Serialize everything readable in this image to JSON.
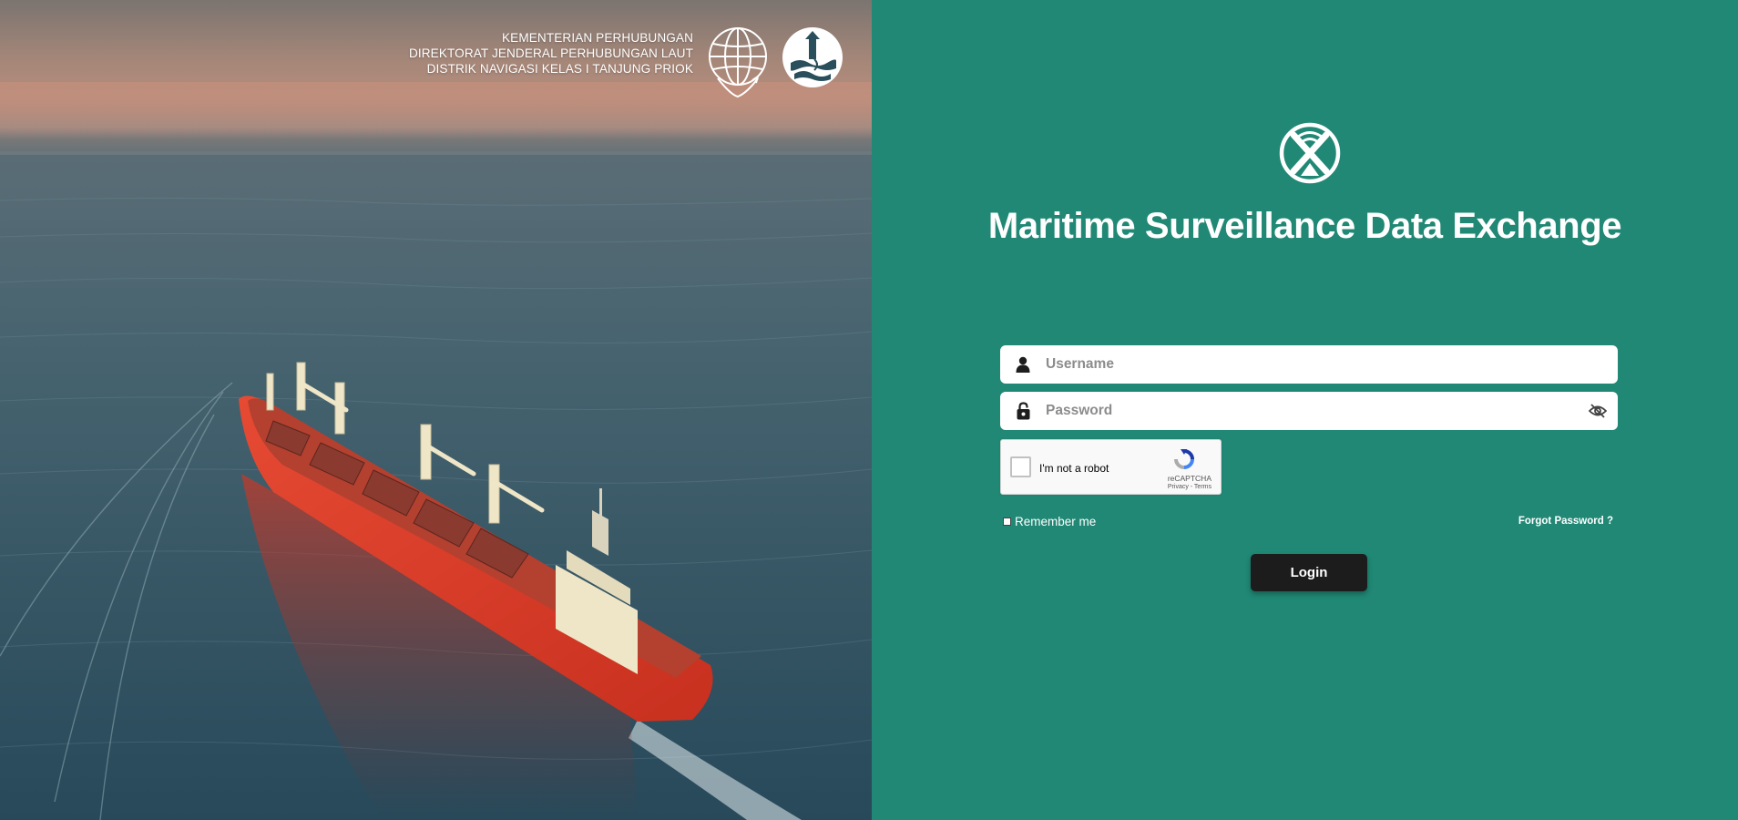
{
  "header": {
    "gov_lines": [
      "KEMENTERIAN PERHUBUNGAN",
      "DIREKTORAT JENDERAL PERHUBUNGAN LAUT",
      "DISTRIK NAVIGASI KELAS I TANJUNG PRIOK"
    ],
    "emblems": [
      "globe-anchor-emblem",
      "lighthouse-emblem"
    ]
  },
  "login": {
    "app_title": "Maritime Surveillance Data Exchange",
    "username_placeholder": "Username",
    "password_placeholder": "Password",
    "captcha_label": "I'm not a robot",
    "captcha_brand": "reCAPTCHA",
    "captcha_links": "Privacy - Terms",
    "remember_label": "Remember me",
    "forgot_label": "Forgot Password ?",
    "login_label": "Login"
  },
  "icons": {
    "brand": "brand-logo-icon",
    "username": "user-icon",
    "password": "lock-icon",
    "toggle_visibility": "eye-slash-icon"
  },
  "colors": {
    "panel_background": "#208875",
    "login_button": "#1c1c1c",
    "text_light": "#ffffff"
  }
}
